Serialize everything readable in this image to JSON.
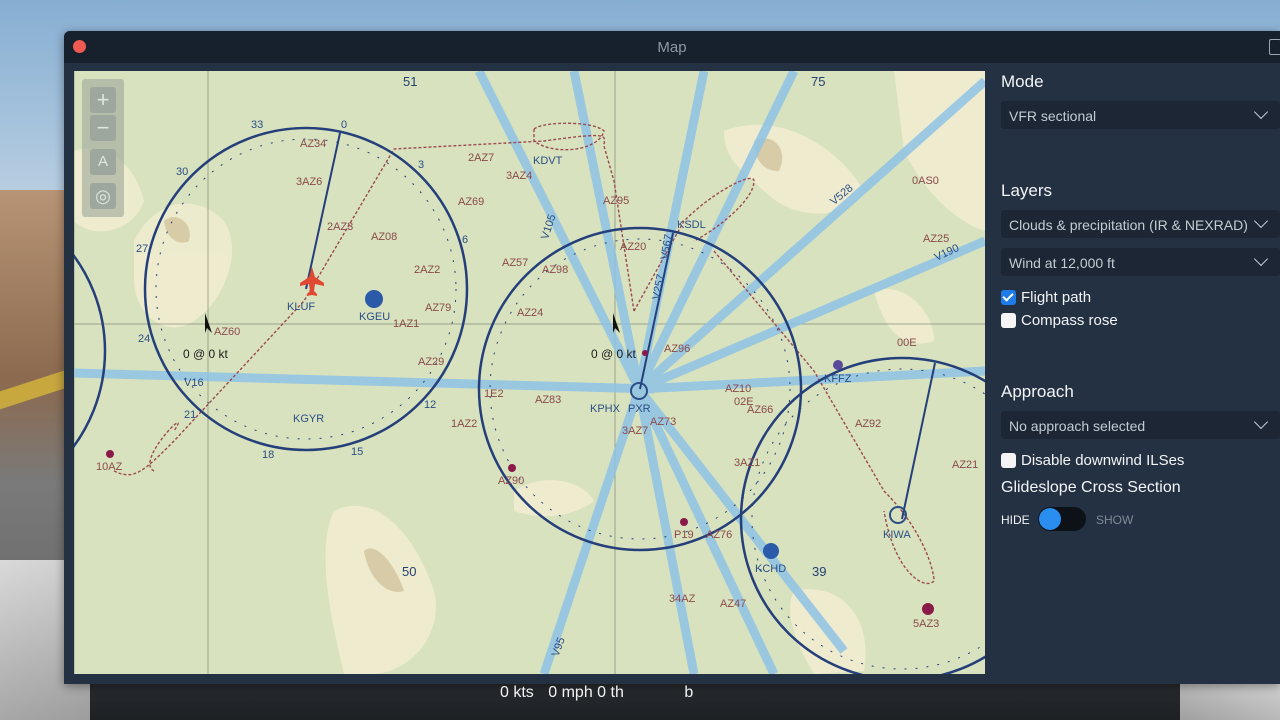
{
  "window": {
    "title": "Map"
  },
  "map": {
    "controls": [
      {
        "name": "zoom-in-icon",
        "glyph": "+"
      },
      {
        "name": "zoom-out-icon",
        "glyph": "−"
      },
      {
        "name": "north-up-icon",
        "glyph": "A"
      },
      {
        "name": "locate-icon",
        "glyph": "◎"
      }
    ],
    "wind_left": "0 @ 0 kt",
    "wind_center": "0 @ 0 kt",
    "airports": [
      "KLUF",
      "KGEU",
      "KGYR",
      "KDVT",
      "KSDL",
      "PXR",
      "KPHX",
      "KCHD",
      "KIWA",
      "KFFZ"
    ],
    "airways": [
      "V16",
      "V105",
      "V257",
      "V567",
      "V528",
      "V190",
      "V95"
    ],
    "area_numbers": [
      "51",
      "75",
      "50",
      "39"
    ],
    "compass_numbers": [
      "0",
      "3",
      "6",
      "12",
      "15",
      "18",
      "21",
      "24",
      "27",
      "30",
      "33"
    ],
    "points": [
      "AZ34",
      "3AZ6",
      "2AZ3",
      "AZ08",
      "2AZ2",
      "AZ79",
      "1AZ1",
      "AZ29",
      "AZ60",
      "10AZ",
      "2AZ7",
      "3AZ4",
      "AZ69",
      "AZ95",
      "AZ20",
      "AZ57",
      "AZ98",
      "AZ24",
      "AZ96",
      "AZ83",
      "1AZ2",
      "AZ90",
      "3AZ7",
      "AZ73",
      "AZ10",
      "02E",
      "AZ66",
      "AZ92",
      "AZ21",
      "3AZ1",
      "P19",
      "AZ76",
      "34AZ",
      "AZ47",
      "5AZ3",
      "0AS0",
      "AZ25",
      "00E",
      "1E2"
    ]
  },
  "panel": {
    "mode_title": "Mode",
    "mode_value": "VFR sectional",
    "layers_title": "Layers",
    "layers_clouds": "Clouds & precipitation (IR & NEXRAD)",
    "layers_wind": "Wind at 12,000 ft",
    "flight_path": {
      "label": "Flight path",
      "checked": true
    },
    "compass_rose": {
      "label": "Compass rose",
      "checked": false
    },
    "approach_title": "Approach",
    "approach_value": "No approach selected",
    "disable_ils": {
      "label": "Disable downwind ILSes",
      "checked": false
    },
    "glideslope_title": "Glideslope Cross Section",
    "toggle_hide": "HIDE",
    "toggle_show": "SHOW"
  },
  "status": {
    "speed_kts": "0 kts",
    "speed_mph": "0 mph",
    "throttle": "0 th",
    "extra": "b"
  },
  "colors": {
    "accent": "#2a8ef0",
    "map_background": "#d9e2be",
    "compass_rose": "#243f7a",
    "airway": "#8ec3e6",
    "flight_path": "#9a4a50",
    "aircraft": "#e04a32"
  }
}
